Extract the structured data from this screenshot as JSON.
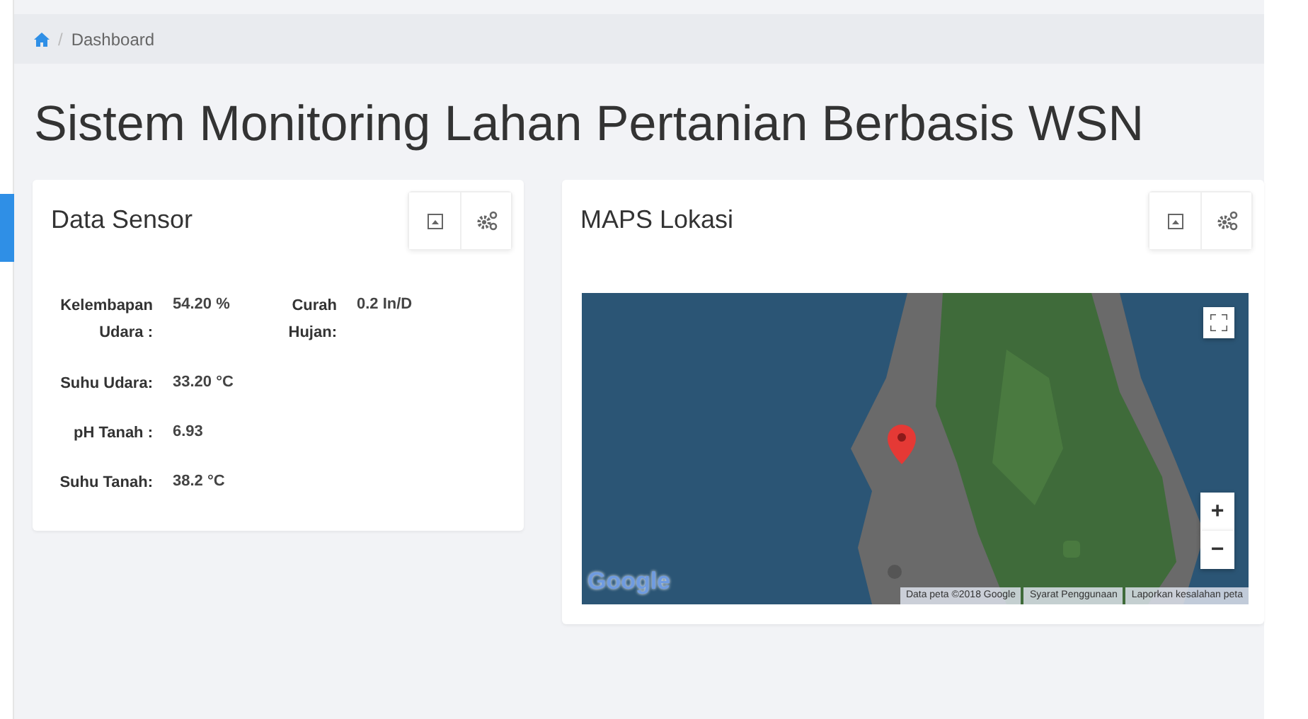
{
  "breadcrumb": {
    "separator": "/",
    "items": [
      "Dashboard"
    ]
  },
  "page_title": "Sistem Monitoring Lahan Pertanian Berbasis WSN",
  "sensor_card": {
    "title": "Data Sensor",
    "rows": [
      [
        {
          "label": "Kelembapan Udara :",
          "value": "54.20 %"
        },
        {
          "label": "Curah Hujan:",
          "value": "0.2 In/D"
        }
      ],
      [
        {
          "label": "Suhu Udara:",
          "value": "33.20 °C"
        }
      ],
      [
        {
          "label": "pH Tanah :",
          "value": "6.93"
        }
      ],
      [
        {
          "label": "Suhu Tanah:",
          "value": "38.2 °C"
        }
      ]
    ]
  },
  "map_card": {
    "title": "MAPS Lokasi",
    "map": {
      "kind": "picture",
      "zoom_in": "+",
      "zoom_out": "−",
      "logo": "Google",
      "attribution": [
        "Data peta ©2018 Google",
        "Syarat Penggunaan",
        "Laporkan kesalahan peta"
      ]
    }
  }
}
